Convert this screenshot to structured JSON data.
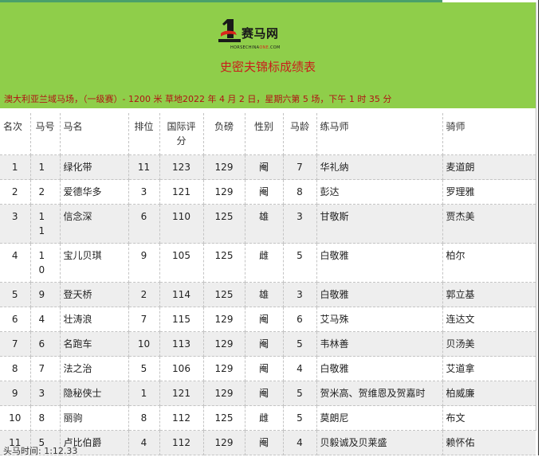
{
  "brand": {
    "logo_text": "赛马网",
    "logo_sub_a": "HORSECHINA",
    "logo_sub_b": "ONE",
    "logo_sub_c": ".COM",
    "accent": "#8fce4a",
    "red": "#c8201c"
  },
  "page": {
    "title": "史密夫锦标成绩表",
    "race_info": "澳大利亚兰域马场，（一级赛）- 1200 米 草地2022 年 4 月 2 日，星期六第 5 场，下午 1 时 35 分",
    "footer": "头马时间: 1:12.33"
  },
  "table": {
    "headers": [
      "名次",
      "马号",
      "马名",
      "排位",
      "国际评分",
      "负磅",
      "性别",
      "马龄",
      "练马师",
      "骑师"
    ],
    "rows": [
      [
        "1",
        "1",
        "绿化带",
        "11",
        "123",
        "129",
        "阉",
        "7",
        "华礼纳",
        "麦道朗"
      ],
      [
        "2",
        "2",
        "爱德华多",
        "3",
        "121",
        "129",
        "阉",
        "8",
        "彭达",
        "罗理雅"
      ],
      [
        "3",
        "11",
        "信念深",
        "6",
        "110",
        "125",
        "雄",
        "3",
        "甘敬斯",
        "贾杰美"
      ],
      [
        "4",
        "10",
        "宝儿贝琪",
        "9",
        "105",
        "125",
        "雌",
        "5",
        "白敬雅",
        "柏尔"
      ],
      [
        "5",
        "9",
        "登天桥",
        "2",
        "114",
        "125",
        "雄",
        "3",
        "白敬雅",
        "郭立基"
      ],
      [
        "6",
        "4",
        "壮涛浪",
        "7",
        "115",
        "129",
        "阉",
        "6",
        "艾马殊",
        "连达文"
      ],
      [
        "7",
        "6",
        "名跑车",
        "10",
        "113",
        "129",
        "阉",
        "5",
        "韦林善",
        "贝汤美"
      ],
      [
        "8",
        "7",
        "法之治",
        "5",
        "106",
        "129",
        "阉",
        "4",
        "白敬雅",
        "艾道拿"
      ],
      [
        "9",
        "3",
        "隐秘侠士",
        "1",
        "121",
        "129",
        "阉",
        "5",
        "贺米高、贺维恩及贺嘉时",
        "柏威廉"
      ],
      [
        "10",
        "8",
        "丽驹",
        "8",
        "112",
        "125",
        "雌",
        "5",
        "莫朗尼",
        "布文"
      ],
      [
        "11",
        "5",
        "卢比伯爵",
        "4",
        "112",
        "129",
        "阉",
        "4",
        "贝毅诚及贝莱盛",
        "赖怀佑"
      ]
    ]
  }
}
